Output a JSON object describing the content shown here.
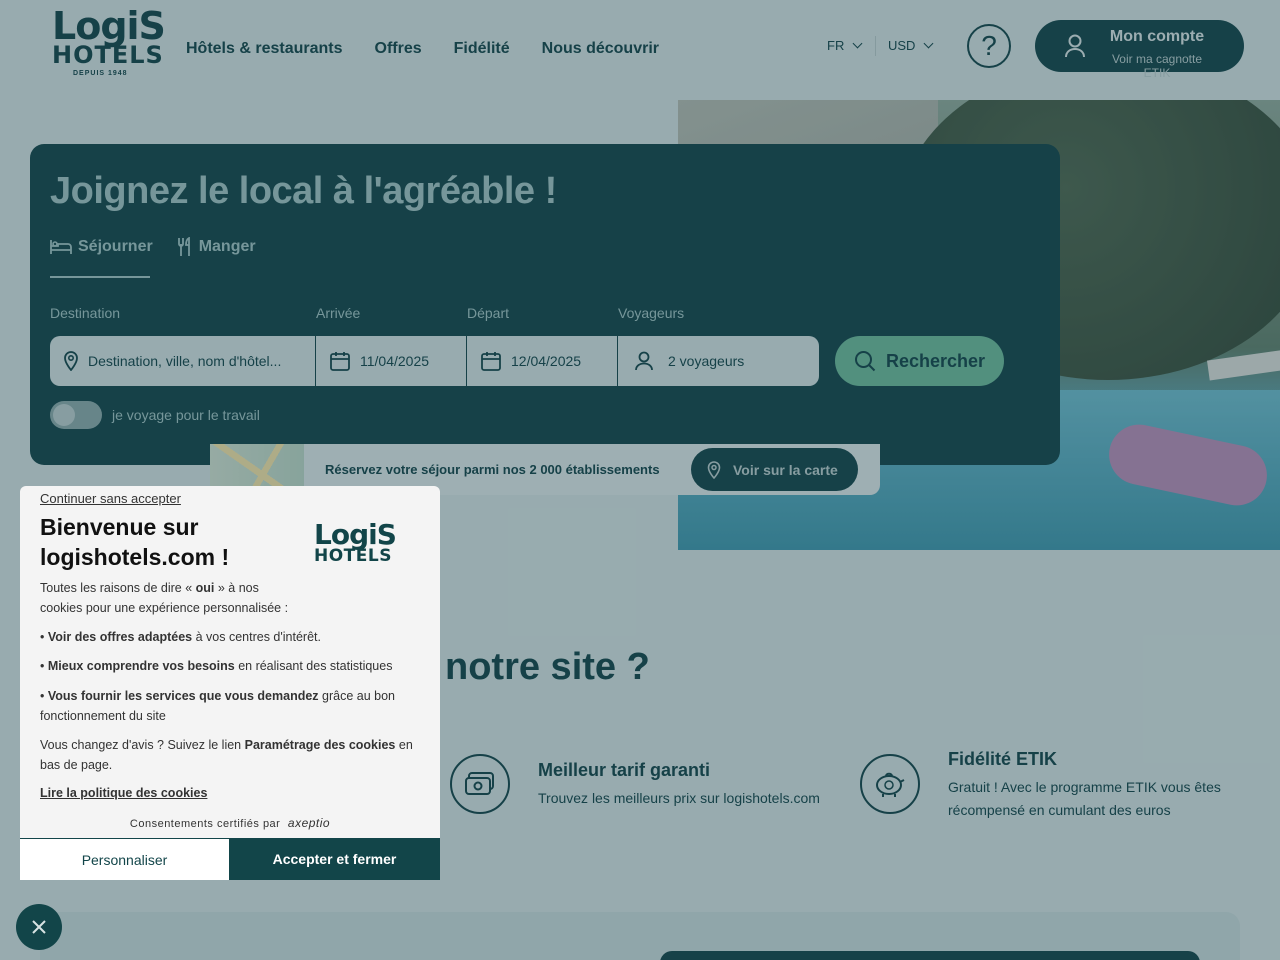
{
  "header": {
    "logo": {
      "line1": "LogiS",
      "line2": "HOTELS",
      "line3": "DEPUIS 1948"
    },
    "nav": [
      "Hôtels & restaurants",
      "Offres",
      "Fidélité",
      "Nous découvrir"
    ],
    "language": "FR",
    "currency": "USD",
    "help_symbol": "?",
    "account": {
      "title": "Mon compte",
      "subtitle": "Voir ma cagnotte ETIK"
    }
  },
  "search": {
    "headline": "Joignez le local à l'agréable !",
    "tabs": [
      {
        "label": "Séjourner",
        "icon": "bed-icon",
        "active": true
      },
      {
        "label": "Manger",
        "icon": "cutlery-icon",
        "active": false
      }
    ],
    "fields": {
      "destination": {
        "label": "Destination",
        "placeholder": "Destination, ville, nom d'hôtel..."
      },
      "arrival": {
        "label": "Arrivée",
        "value": "11/04/2025"
      },
      "departure": {
        "label": "Départ",
        "value": "12/04/2025"
      },
      "travellers": {
        "label": "Voyageurs",
        "value": "2 voyageurs"
      }
    },
    "submit": "Rechercher",
    "business_toggle": {
      "label": "je voyage pour le travail",
      "on": false
    }
  },
  "map_strip": {
    "text": "Réservez votre séjour parmi nos 2 000 établissements",
    "button": "Voir sur la carte"
  },
  "why": {
    "title": "notre site ?",
    "features": [
      {
        "icon": "money-icon",
        "title": "Meilleur tarif garanti",
        "text": "Trouvez les meilleurs prix sur logishotels.com"
      },
      {
        "icon": "piggy-bank-icon",
        "title": "Fidélité ETIK",
        "text": "Gratuit ! Avec le programme ETIK vous êtes récompensé en cumulant des euros"
      }
    ]
  },
  "cookie": {
    "skip": "Continuer sans accepter",
    "title": "Bienvenue sur logishotels.com !",
    "logo": {
      "line1": "LogiS",
      "line2": "HOTELS"
    },
    "intro_a": "Toutes les raisons de dire « ",
    "intro_b": "oui",
    "intro_c": " » à nos cookies pour une expérience personnalisée :",
    "bullets": [
      {
        "bold": "Voir des offres adaptées",
        "rest": " à vos centres d'intérêt."
      },
      {
        "bold": "Mieux comprendre vos besoins",
        "rest": " en réalisant des statistiques"
      },
      {
        "bold": "Vous fournir les services que vous demandez",
        "rest": " grâce au bon fonctionnement du site"
      }
    ],
    "change_a": "Vous changez d'avis ? Suivez le lien ",
    "change_b": "Paramétrage des cookies",
    "change_c": " en bas de page.",
    "policy": "Lire la politique des cookies",
    "certified": "Consentements certifiés par",
    "certifier": "axeptio",
    "customize": "Personnaliser",
    "accept": "Accepter et fermer"
  },
  "colors": {
    "brand": "#124549",
    "accent": "#6ab899",
    "soft": "#9fc2c1"
  }
}
